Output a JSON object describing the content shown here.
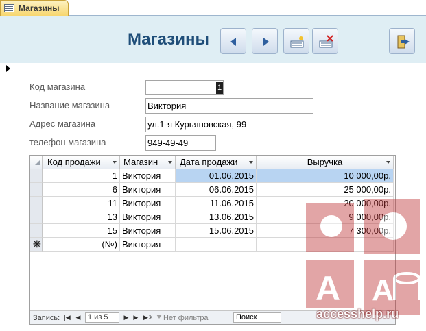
{
  "tab": {
    "label": "Магазины"
  },
  "header": {
    "title": "Магазины"
  },
  "fields": {
    "code": {
      "label": "Код магазина",
      "value": "",
      "caret_char": "1"
    },
    "name": {
      "label": "Название магазина",
      "value": "Виктория"
    },
    "address": {
      "label": "Адрес магазина",
      "value": "ул.1-я Курьяновская, 99"
    },
    "phone": {
      "label": "телефон магазина",
      "value": "949-49-49"
    }
  },
  "subform": {
    "columns": [
      "Код продажи",
      "Магазин",
      "Дата продажи",
      "Выручка"
    ],
    "rows": [
      [
        "1",
        "Виктория",
        "01.06.2015",
        "10 000,00р."
      ],
      [
        "6",
        "Виктория",
        "06.06.2015",
        "25 000,00р."
      ],
      [
        "11",
        "Виктория",
        "11.06.2015",
        "20 000,00р."
      ],
      [
        "13",
        "Виктория",
        "13.06.2015",
        "9 000,00р."
      ],
      [
        "15",
        "Виктория",
        "15.06.2015",
        "7 300,00р."
      ]
    ],
    "new_row": [
      "(№)",
      "Виктория"
    ]
  },
  "navbar": {
    "label": "Запись:",
    "counter": "1 из 5",
    "filter": "Нет фильтра",
    "search": "Поиск"
  },
  "watermark": {
    "text": "accesshelp.ru"
  },
  "colors": {
    "accent": "#1f4e79",
    "header_bg": "#dfeef4",
    "selection": "#b8d4f2",
    "watermark": "#c0393b"
  }
}
